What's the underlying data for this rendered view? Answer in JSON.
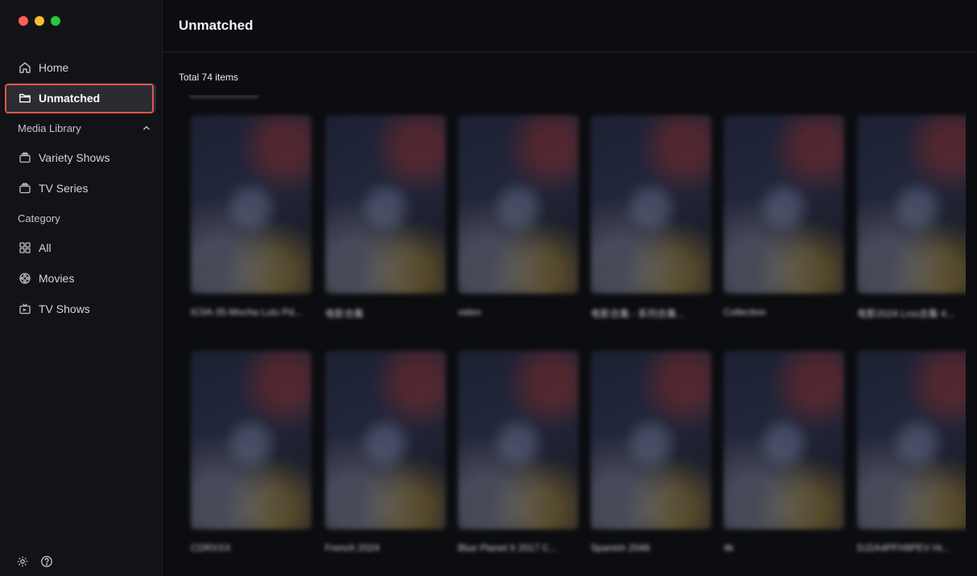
{
  "window": {
    "traffic_lights": {
      "close": "#ff5f57",
      "minimize": "#febc2e",
      "maximize": "#28c840"
    }
  },
  "sidebar": {
    "items_top": [
      {
        "label": "Home",
        "icon": "home-icon"
      },
      {
        "label": "Unmatched",
        "icon": "folder-icon",
        "active": true
      }
    ],
    "media_library": {
      "title": "Media Library",
      "expanded": true,
      "items": [
        {
          "label": "Variety Shows",
          "icon": "stack-icon"
        },
        {
          "label": "TV Series",
          "icon": "stack-icon"
        }
      ]
    },
    "category": {
      "title": "Category",
      "items": [
        {
          "label": "All",
          "icon": "grid-icon"
        },
        {
          "label": "Movies",
          "icon": "film-reel-icon"
        },
        {
          "label": "TV Shows",
          "icon": "tv-icon"
        }
      ]
    },
    "bottom_icons": [
      "gear-icon",
      "help-icon"
    ]
  },
  "main": {
    "title": "Unmatched",
    "total_label": "Total 74 items",
    "accent_color": "#e5544e",
    "grid": {
      "rows": [
        [
          {
            "caption": "IC0A-35-Mocha Lulu Pd..."
          },
          {
            "caption": "电影合集"
          },
          {
            "caption": "video"
          },
          {
            "caption": "电影合集 - 系列合集..."
          },
          {
            "caption": "Collection"
          },
          {
            "caption": "电影2024 Lrss合集 4..."
          }
        ],
        [
          {
            "caption": "CDRXXX"
          },
          {
            "caption": "French 2024"
          },
          {
            "caption": "Blue Planet II 2017 C..."
          },
          {
            "caption": "Spanish 2048"
          },
          {
            "caption": "4k"
          },
          {
            "caption": "DJ2A4PFH9PEV Hi..."
          }
        ]
      ]
    }
  }
}
